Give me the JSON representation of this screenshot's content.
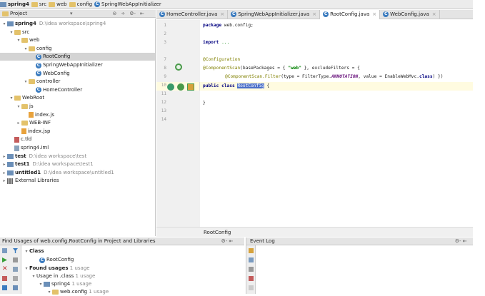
{
  "breadcrumb": [
    "spring4",
    "src",
    "web",
    "config",
    "SpringWebAppInitializer"
  ],
  "project_panel": {
    "title": "Project",
    "dropdown": "▾",
    "tools": [
      "⊜",
      "÷",
      "⚙-",
      "⇤"
    ]
  },
  "tree": [
    {
      "label": "spring4",
      "path": "D:\\idea workspace\\spring4",
      "indent": 0,
      "tw": "▾",
      "icon": "mod",
      "bold": true
    },
    {
      "label": "src",
      "indent": 1,
      "tw": "▾",
      "icon": "fold"
    },
    {
      "label": "web",
      "indent": 2,
      "tw": "▾",
      "icon": "fold"
    },
    {
      "label": "config",
      "indent": 3,
      "tw": "▾",
      "icon": "fold"
    },
    {
      "label": "RootConfig",
      "indent": 4,
      "tw": "",
      "icon": "cls",
      "selected": true
    },
    {
      "label": "SpringWebAppInitializer",
      "indent": 4,
      "tw": "",
      "icon": "cls"
    },
    {
      "label": "WebConfig",
      "indent": 4,
      "tw": "",
      "icon": "cls"
    },
    {
      "label": "controller",
      "indent": 3,
      "tw": "▾",
      "icon": "fold"
    },
    {
      "label": "HomeController",
      "indent": 4,
      "tw": "",
      "icon": "cls"
    },
    {
      "label": "WebRoot",
      "indent": 1,
      "tw": "▾",
      "icon": "fold"
    },
    {
      "label": "js",
      "indent": 2,
      "tw": "▾",
      "icon": "fold"
    },
    {
      "label": "index.js",
      "indent": 3,
      "tw": "",
      "icon": "file"
    },
    {
      "label": "WEB-INF",
      "indent": 2,
      "tw": "▸",
      "icon": "fold"
    },
    {
      "label": "index.jsp",
      "indent": 2,
      "tw": "",
      "icon": "file"
    },
    {
      "label": "c.tld",
      "indent": 1,
      "tw": "",
      "icon": "xfile"
    },
    {
      "label": "spring4.iml",
      "indent": 1,
      "tw": "",
      "icon": "imlfile"
    },
    {
      "label": "test",
      "path": "D:\\idea workspace\\test",
      "indent": 0,
      "tw": "▸",
      "icon": "mod",
      "bold": true
    },
    {
      "label": "test1",
      "path": "D:\\idea workspace\\test1",
      "indent": 0,
      "tw": "▸",
      "icon": "mod",
      "bold": true
    },
    {
      "label": "untitled1",
      "path": "D:\\idea workspace\\untitled1",
      "indent": 0,
      "tw": "▸",
      "icon": "mod",
      "bold": true
    },
    {
      "label": "External Libraries",
      "indent": 0,
      "tw": "▸",
      "icon": "libs"
    }
  ],
  "tabs": [
    {
      "label": "HomeController.java",
      "close": "×"
    },
    {
      "label": "SpringWebAppInitializer.java",
      "close": "×"
    },
    {
      "label": "RootConfig.java",
      "close": "×",
      "active": true
    },
    {
      "label": "WebConfig.java",
      "close": "×"
    }
  ],
  "line_numbers": [
    "1",
    "2",
    "3",
    "7",
    "8",
    "9",
    "10",
    "11",
    "12",
    "13",
    "14"
  ],
  "code": {
    "l1_kw": "package",
    "l1_rest": " web.config;",
    "l3_kw": "import",
    "l3_rest": " ...",
    "l7": "@Configuration",
    "l8_a": "@ComponentScan",
    "l8_b": "(basePackages = { ",
    "l8_s": "\"web\"",
    "l8_c": " }, excludeFilters = {",
    "l9_a": "@ComponentScan.Filter",
    "l9_b": "(type = FilterType.",
    "l9_i": "ANNOTATION",
    "l9_c": ", value = EnableWebMvc.",
    "l9_kw": "class",
    "l9_d": ") })",
    "l10_kw": "public class",
    "l10_sel": "RootConfig",
    "l10_rest": " {",
    "l12": "}"
  },
  "editor_breadcrumb": "RootConfig",
  "find": {
    "title": "Find Usages of web.config.RootConfig in Project and Libraries",
    "tools": "⚙- ⇤",
    "class_label": "Class",
    "class_item": "RootConfig",
    "found": "Found usages",
    "found_count": "1 usage",
    "usage_class": "Usage in .class",
    "usage_count": "1 usage",
    "mod": "spring4",
    "mod_count": "1 usage",
    "pkg": "web.config",
    "pkg_count": "1 usage"
  },
  "event_log": {
    "title": "Event Log",
    "tools": "⚙- ⇤"
  },
  "colors": {
    "accent": "#4a6fc9",
    "selection": "#d4d4d4",
    "caret_line": "#fffbe0"
  }
}
